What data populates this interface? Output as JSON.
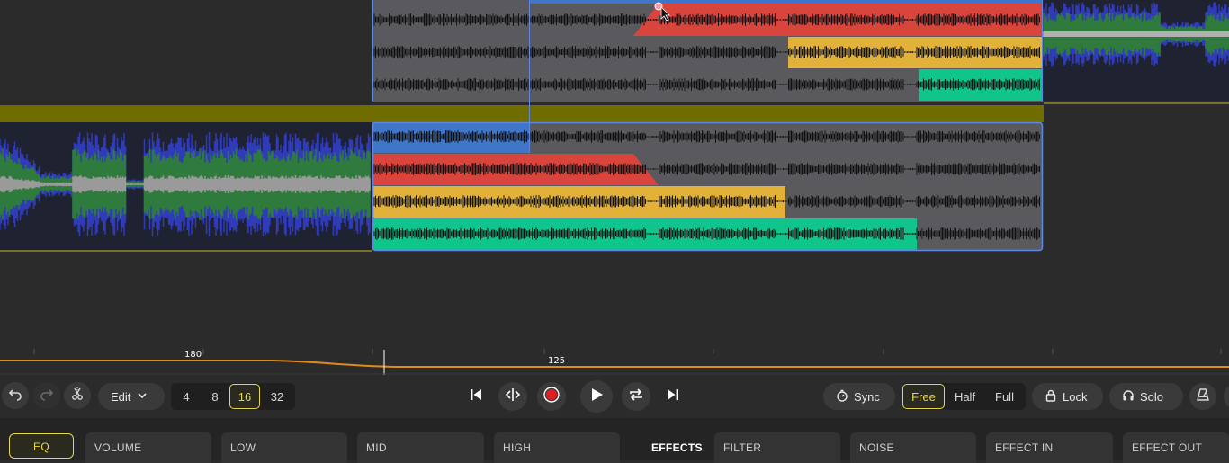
{
  "colors": {
    "background": "#2b2b2b",
    "accent_yellow": "#e6d84a",
    "blue": "#3f76c9",
    "red": "#d9443d",
    "gold": "#e2b13a",
    "teal": "#10c58b",
    "olive": "#6f6c00",
    "tempo_line": "#e08a1c",
    "record_red": "#e02020"
  },
  "tempo": {
    "marker_left": "180",
    "marker_right": "125"
  },
  "toolbar": {
    "edit_label": "Edit",
    "beat_options": [
      "4",
      "8",
      "16",
      "32"
    ],
    "beat_selected": "16",
    "sync_label": "Sync",
    "mode_options": [
      "Free",
      "Half",
      "Full"
    ],
    "mode_selected": "Free",
    "lock_label": "Lock",
    "solo_label": "Solo"
  },
  "tabs": {
    "eq": "EQ",
    "volume": "VOLUME",
    "low": "LOW",
    "mid": "MID",
    "high": "HIGH",
    "effects": "EFFECTS",
    "filter": "FILTER",
    "noise": "NOISE",
    "effect_in": "EFFECT IN",
    "effect_out": "EFFECT OUT"
  },
  "icons": {
    "undo": "undo-icon",
    "redo": "redo-icon",
    "split": "scissors-icon",
    "skip_back": "skip-back-icon",
    "cue": "cue-split-icon",
    "record": "record-icon",
    "play": "play-icon",
    "loop": "loop-icon",
    "skip_forward": "skip-forward-icon",
    "sync": "stopwatch-icon",
    "lock": "lock-icon",
    "solo": "headphones-icon",
    "metronome": "metronome-icon"
  }
}
